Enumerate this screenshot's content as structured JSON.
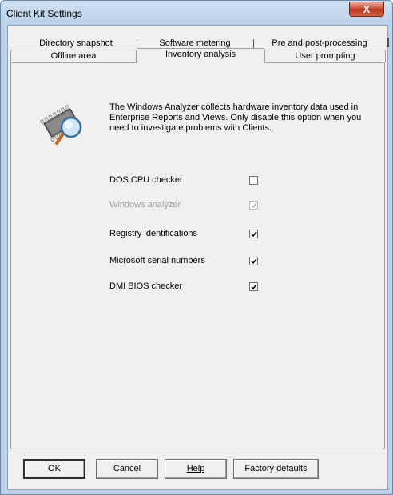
{
  "window": {
    "title": "Client Kit Settings",
    "close_label": "X"
  },
  "tabs_row1": [
    {
      "label": "Directory snapshot"
    },
    {
      "label": "Software metering"
    },
    {
      "label": "Pre and post-processing"
    }
  ],
  "tabs_row2": [
    {
      "label": "Offline area"
    },
    {
      "label": "Inventory analysis",
      "selected": true
    },
    {
      "label": "User prompting"
    }
  ],
  "panel": {
    "description": "The Windows Analyzer collects hardware inventory data used in Enterprise Reports and Views. Only disable this option when you need  to investigate problems with Clients.",
    "icon": "inventory-magnifier-icon",
    "options": [
      {
        "label": "DOS CPU checker",
        "checked": false,
        "disabled": false
      },
      {
        "label": "Windows analyzer",
        "checked": true,
        "disabled": true
      },
      {
        "label": "Registry identifications",
        "checked": true,
        "disabled": false
      },
      {
        "label": "Microsoft serial numbers",
        "checked": true,
        "disabled": false
      },
      {
        "label": "DMI BIOS checker",
        "checked": true,
        "disabled": false
      }
    ]
  },
  "buttons": {
    "ok": "OK",
    "cancel": "Cancel",
    "help": "Help",
    "factory_defaults": "Factory defaults"
  }
}
